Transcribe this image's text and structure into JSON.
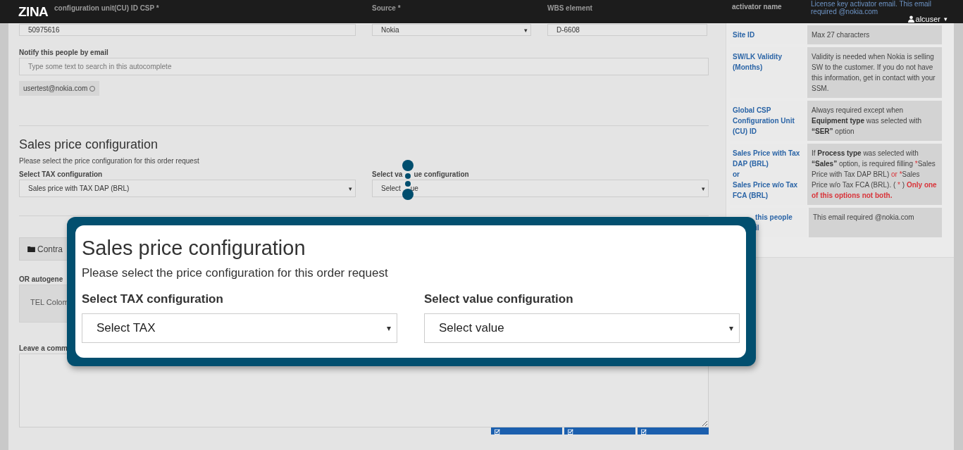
{
  "header": {
    "logo": "ZINA",
    "user": "alcuser",
    "caret": "▾"
  },
  "form": {
    "top_fields": [
      {
        "kind": "input",
        "label": "configuration unit(CU) ID CSP *",
        "value": "50975616"
      },
      {
        "kind": "select",
        "label": "Source *",
        "value": "Nokia",
        "caret": "▾"
      },
      {
        "kind": "input",
        "label": "WBS element",
        "value": "D-6608"
      }
    ],
    "notify": {
      "label": "Notify this people by email",
      "placeholder": "Type some text to search in this autocomplete",
      "tags": [
        "usertest@nokia.com"
      ]
    },
    "sales": {
      "title": "Sales price configuration",
      "description": "Please select the price configuration for this order request",
      "tax": {
        "label": [
          "Select TAX configuration"
        ],
        "value": [
          "Sales price with TAX DAP (BRL)"
        ],
        "caret": "▾"
      },
      "value_config": {
        "label": [
          "Select va",
          "ue configuration"
        ],
        "value": [
          "Select",
          "ue"
        ],
        "caret": "▾"
      }
    },
    "contract_button": "Contra",
    "autogen": {
      "label": "OR autogene",
      "value": "TEL Colom"
    },
    "comment": {
      "label": "Leave a comm"
    },
    "action_buttons": [
      {
        "kind": "check"
      },
      {
        "kind": "check"
      },
      {
        "kind": "check"
      }
    ]
  },
  "help_table": {
    "rows": [
      {
        "term": [
          "activator name"
        ],
        "description": [
          {
            "kind": "link",
            "text": "License key activator email. This email required @nokia.com"
          }
        ]
      },
      {
        "term": [
          "Site ID"
        ],
        "description": [
          {
            "kind": "note",
            "text": "Max 27 characters"
          }
        ]
      },
      {
        "term": [
          "SW/LK Validity",
          "(Months)"
        ],
        "description": [
          {
            "kind": "note",
            "text": "Validity is needed when Nokia is selling SW to the customer. If you do not have this information, get in contact with your SSM."
          }
        ]
      },
      {
        "term": [
          "Global CSP",
          "Configuration Unit",
          "(CU) ID"
        ],
        "description": [
          {
            "kind": "note",
            "text": "Always required except when **Equipment type** was selected with **“SER”** option"
          }
        ]
      },
      {
        "term": [
          "Sales Price with Tax",
          "DAP (BRL)",
          "or",
          "Sales Price w/o Tax",
          "FCA (BRL)"
        ],
        "description": [
          {
            "kind": "note",
            "text": "If **Process type** was selected with **“Sales”** option, is required filling "
          },
          {
            "kind": "alert",
            "text": "*"
          },
          {
            "kind": "note",
            "text": "Sales Price with Tax DAP BRL) "
          },
          {
            "kind": "alert",
            "text": "or *"
          },
          {
            "kind": "note",
            "text": "Sales Price w/o Tax FCA (BRL). ( "
          },
          {
            "kind": "alert",
            "text": "*"
          },
          {
            "kind": "note",
            "text": " ) "
          },
          {
            "kind": "alert",
            "text": "**Only one of this options not both.**"
          }
        ]
      },
      {
        "term": [
          "this people",
          "il"
        ],
        "description": [
          {
            "kind": "note",
            "text": "This email required @nokia.com"
          }
        ]
      }
    ]
  },
  "modal": {
    "title": "Sales price configuration",
    "description": "Please select the price configuration for this order request",
    "tax": {
      "label": "Select TAX configuration",
      "value": "Select TAX",
      "caret": "▾"
    },
    "value_config": {
      "label": "Select value configuration",
      "value": "Select value",
      "caret": "▾"
    }
  }
}
